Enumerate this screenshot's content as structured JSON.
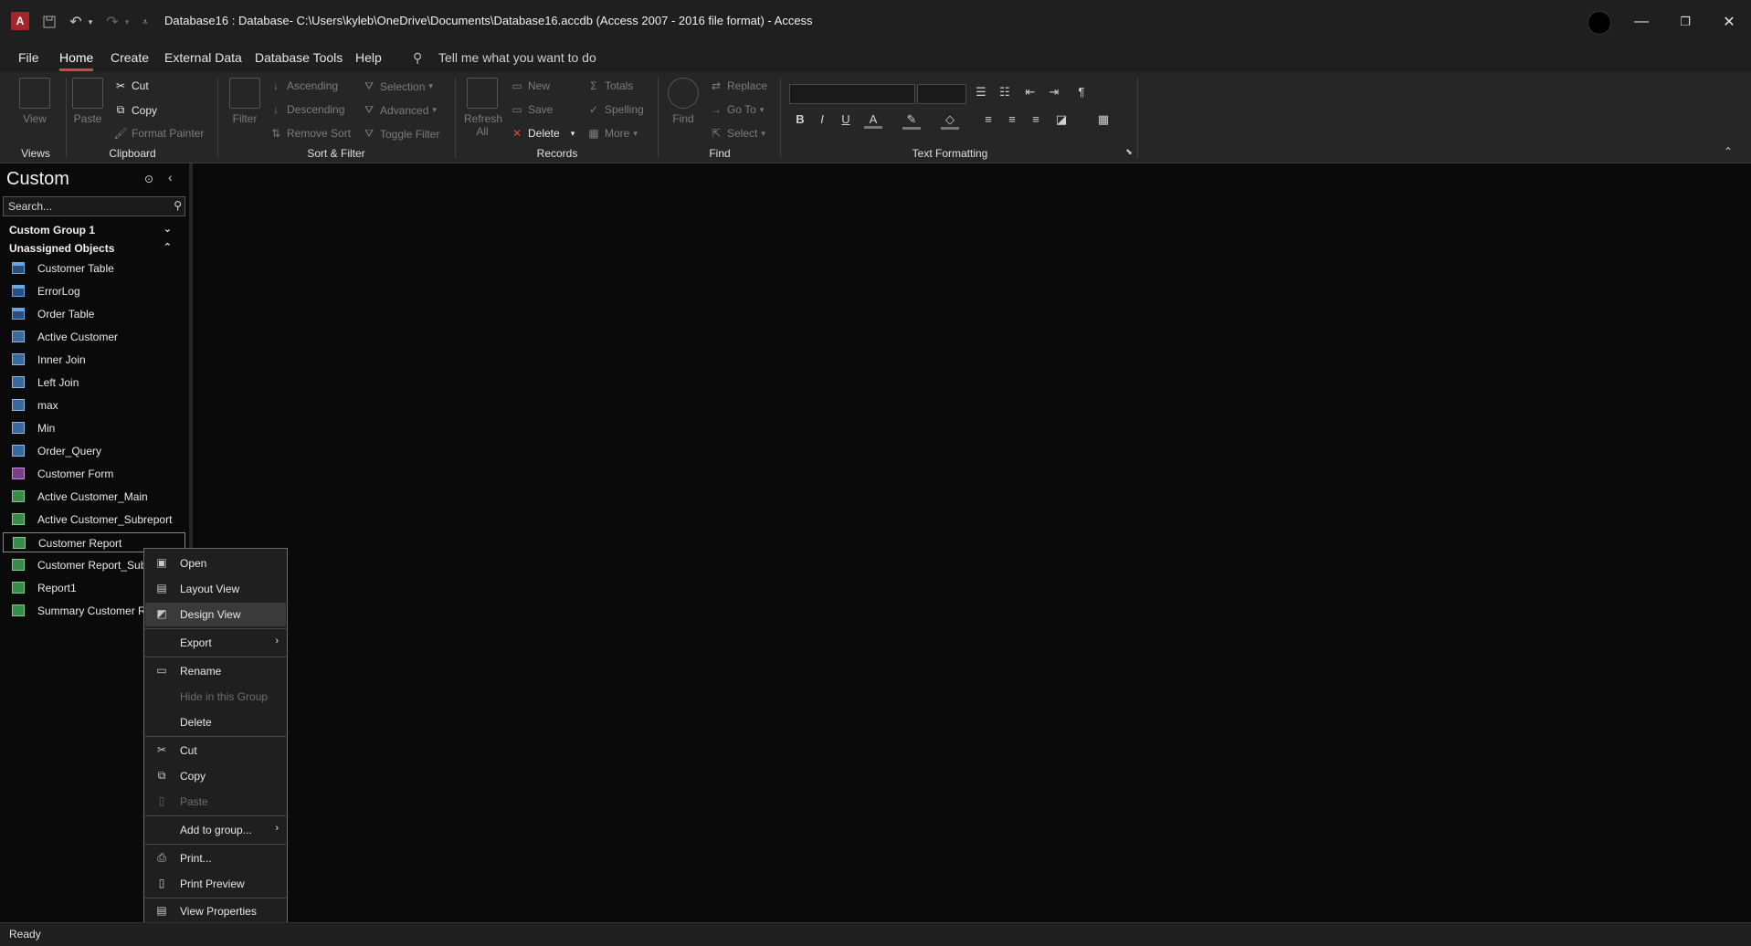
{
  "titlebar": {
    "app_icon": "A",
    "title": "Database16 : Database- C:\\Users\\kyleb\\OneDrive\\Documents\\Database16.accdb (Access 2007 - 2016 file format)  -  Access",
    "icons": [
      "save-icon",
      "undo-icon",
      "redo-icon",
      "customize-qat-icon"
    ]
  },
  "menu": {
    "tabs": [
      "File",
      "Home",
      "Create",
      "External Data",
      "Database Tools",
      "Help"
    ],
    "tell_me": "Tell me what you want to do"
  },
  "ribbon": {
    "groups": {
      "views": "Views",
      "clipboard": "Clipboard",
      "sort_filter": "Sort & Filter",
      "records": "Records",
      "find": "Find",
      "text_formatting": "Text Formatting"
    },
    "view": "View",
    "paste": "Paste",
    "cut": "Cut",
    "copy": "Copy",
    "format_painter": "Format Painter",
    "filter": "Filter",
    "ascending": "Ascending",
    "descending": "Descending",
    "remove_sort": "Remove Sort",
    "selection": "Selection",
    "advanced": "Advanced",
    "toggle_filter": "Toggle Filter",
    "refresh_all": "Refresh",
    "refresh_all_2": "All",
    "new": "New",
    "save": "Save",
    "delete": "Delete",
    "totals": "Totals",
    "spelling": "Spelling",
    "more": "More",
    "find": "Find",
    "replace": "Replace",
    "go_to": "Go To",
    "select": "Select"
  },
  "nav": {
    "title": "Custom",
    "search_placeholder": "Search...",
    "groups": [
      {
        "label": "Custom Group 1",
        "chev": "⌄"
      },
      {
        "label": "Unassigned Objects",
        "chev": "⌃"
      }
    ],
    "items": [
      {
        "label": "Customer Table",
        "type": "table"
      },
      {
        "label": "ErrorLog",
        "type": "table"
      },
      {
        "label": "Order Table",
        "type": "table"
      },
      {
        "label": "Active Customer",
        "type": "query"
      },
      {
        "label": "Inner Join",
        "type": "query"
      },
      {
        "label": "Left Join",
        "type": "query"
      },
      {
        "label": "max",
        "type": "query"
      },
      {
        "label": "Min",
        "type": "query"
      },
      {
        "label": "Order_Query",
        "type": "query"
      },
      {
        "label": "Customer Form",
        "type": "form"
      },
      {
        "label": "Active Customer_Main",
        "type": "report"
      },
      {
        "label": "Active Customer_Subreport",
        "type": "report"
      },
      {
        "label": "Customer Report",
        "type": "report"
      },
      {
        "label": "Customer Report_Subreport",
        "type": "report"
      },
      {
        "label": "Report1",
        "type": "report"
      },
      {
        "label": "Summary Customer Report",
        "type": "report"
      }
    ]
  },
  "context_menu": {
    "items": [
      {
        "label": "Open",
        "icon": "open-icon"
      },
      {
        "label": "Layout View",
        "icon": "layout-view-icon"
      },
      {
        "label": "Design View",
        "icon": "design-view-icon"
      },
      {
        "label": "Export",
        "icon": ""
      },
      {
        "label": "Rename",
        "icon": "rename-icon"
      },
      {
        "label": "Hide in this Group",
        "icon": ""
      },
      {
        "label": "Delete",
        "icon": ""
      },
      {
        "label": "Cut",
        "icon": "cut-icon"
      },
      {
        "label": "Copy",
        "icon": "copy-icon"
      },
      {
        "label": "Paste",
        "icon": "paste-icon"
      },
      {
        "label": "Add to group...",
        "icon": ""
      },
      {
        "label": "Print...",
        "icon": "print-icon"
      },
      {
        "label": "Print Preview",
        "icon": "print-preview-icon"
      },
      {
        "label": "View Properties",
        "icon": "properties-icon"
      }
    ]
  },
  "status": {
    "text": "Ready"
  },
  "colors": {
    "accent": "#c74a50",
    "background": "#0a0a0a",
    "chrome": "#1f1f1f",
    "ribbon": "#262626"
  }
}
